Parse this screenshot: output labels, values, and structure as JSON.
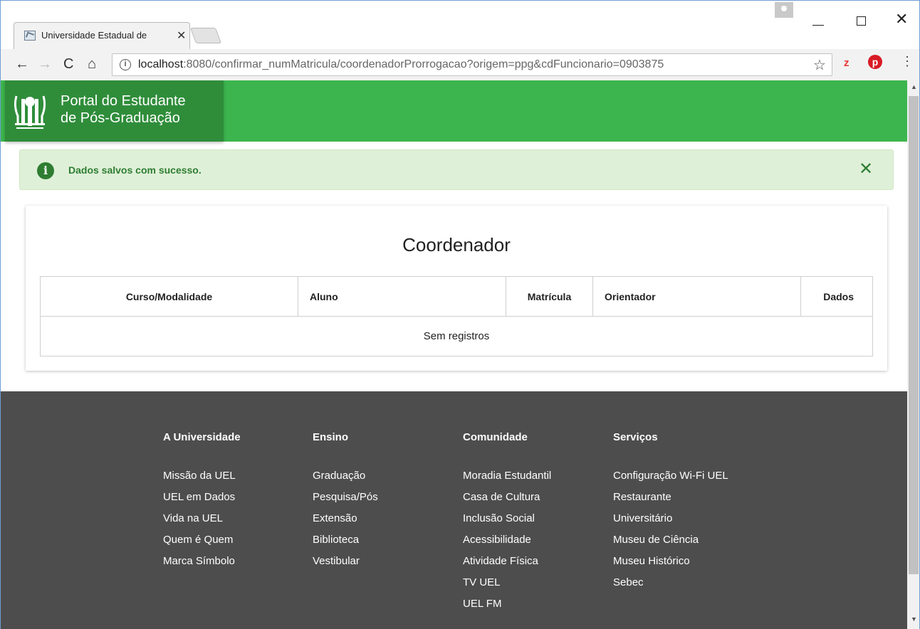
{
  "browser": {
    "tab_title": "Universidade Estadual de",
    "tab_close": "✕",
    "url_host": "localhost",
    "url_rest": ":8080/confirmar_numMatricula/coordenadorProrrogacao?origem=ppg&cdFuncionario=0903875",
    "ext_z": "z",
    "ext_p": "p"
  },
  "header": {
    "brand_line1": "Portal do Estudante",
    "brand_line2": "de Pós-Graduação"
  },
  "alert": {
    "icon": "i",
    "message": "Dados salvos com sucesso.",
    "close": "✕"
  },
  "card": {
    "title": "Coordenador",
    "columns": [
      "Curso/Modalidade",
      "Aluno",
      "Matrícula",
      "Orientador",
      "Dados"
    ],
    "empty_message": "Sem registros"
  },
  "footer": {
    "columns": [
      {
        "heading": "A Universidade",
        "links": [
          "Missão da UEL",
          "UEL em Dados",
          "Vida na UEL",
          "Quem é Quem",
          "Marca Símbolo"
        ]
      },
      {
        "heading": "Ensino",
        "links": [
          "Graduação",
          "Pesquisa/Pós",
          "Extensão",
          "Biblioteca",
          "Vestibular"
        ]
      },
      {
        "heading": "Comunidade",
        "links": [
          "Moradia Estudantil",
          "Casa de Cultura",
          "Inclusão Social",
          "Acessibilidade",
          "Atividade Física",
          "TV UEL",
          "UEL FM"
        ]
      },
      {
        "heading": "Serviços",
        "links": [
          "Configuração Wi-Fi UEL",
          "Restaurante",
          "Universitário",
          "Museu de Ciência",
          "Museu Histórico",
          "Sebec"
        ]
      }
    ]
  },
  "colors": {
    "header_green": "#3cb54e",
    "brand_green": "#2f8d3a",
    "alert_bg": "#dff0d8",
    "alert_text": "#2e7d32",
    "footer_bg": "#4d4d4d"
  },
  "icons": [
    "favicon-icon",
    "tab-close-icon",
    "back-icon",
    "forward-icon",
    "reload-icon",
    "home-icon",
    "info-icon",
    "star-icon",
    "menu-icon",
    "uel-logo-icon",
    "alert-info-icon",
    "alert-close-icon"
  ]
}
